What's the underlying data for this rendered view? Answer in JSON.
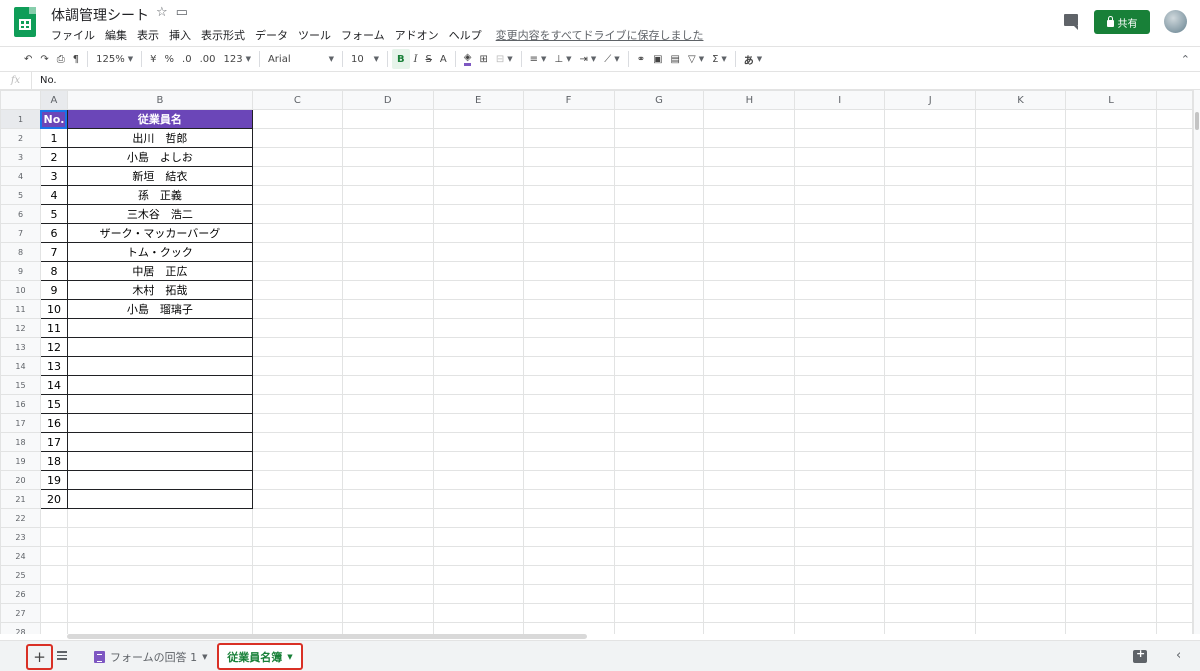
{
  "header": {
    "title": "体調管理シート",
    "menu": [
      "ファイル",
      "編集",
      "表示",
      "挿入",
      "表示形式",
      "データ",
      "ツール",
      "フォーム",
      "アドオン",
      "ヘルプ"
    ],
    "saved_status": "変更内容をすべてドライブに保存しました",
    "share_label": "共有"
  },
  "toolbar": {
    "zoom": "125%",
    "currency": "¥",
    "percent": "%",
    "dec_decrease": ".0",
    "dec_increase": ".00",
    "more_formats": "123",
    "font": "Arial",
    "font_size": "10",
    "bold": "B",
    "italic": "I",
    "strike": "S",
    "text_color": "A",
    "input_tools": "あ"
  },
  "formula_bar": {
    "fx": "fx",
    "value": "No."
  },
  "columns": [
    "A",
    "B",
    "C",
    "D",
    "E",
    "F",
    "G",
    "H",
    "I",
    "J",
    "K",
    "L"
  ],
  "table": {
    "header_no": "No.",
    "header_name": "従業員名",
    "rows": [
      {
        "no": "1",
        "name": "出川　哲郎"
      },
      {
        "no": "2",
        "name": "小島　よしお"
      },
      {
        "no": "3",
        "name": "新垣　結衣"
      },
      {
        "no": "4",
        "name": "孫　正義"
      },
      {
        "no": "5",
        "name": "三木谷　浩二"
      },
      {
        "no": "6",
        "name": "ザーク・マッカーバーグ"
      },
      {
        "no": "7",
        "name": "トム・クック"
      },
      {
        "no": "8",
        "name": "中居　正広"
      },
      {
        "no": "9",
        "name": "木村　拓哉"
      },
      {
        "no": "10",
        "name": "小島　瑠璃子"
      },
      {
        "no": "11",
        "name": ""
      },
      {
        "no": "12",
        "name": ""
      },
      {
        "no": "13",
        "name": ""
      },
      {
        "no": "14",
        "name": ""
      },
      {
        "no": "15",
        "name": ""
      },
      {
        "no": "16",
        "name": ""
      },
      {
        "no": "17",
        "name": ""
      },
      {
        "no": "18",
        "name": ""
      },
      {
        "no": "19",
        "name": ""
      },
      {
        "no": "20",
        "name": ""
      }
    ]
  },
  "row_numbers": [
    "1",
    "2",
    "3",
    "4",
    "5",
    "6",
    "7",
    "8",
    "9",
    "10",
    "11",
    "12",
    "13",
    "14",
    "15",
    "16",
    "17",
    "18",
    "19",
    "20",
    "21",
    "22",
    "23",
    "24",
    "25",
    "26",
    "27",
    "28"
  ],
  "sheets": {
    "form_tab": "フォームの回答 1",
    "active_tab": "従業員名簿"
  },
  "colors": {
    "header_fill": "#6b46b8",
    "share_green": "#188038",
    "highlight_red": "#d93025"
  }
}
